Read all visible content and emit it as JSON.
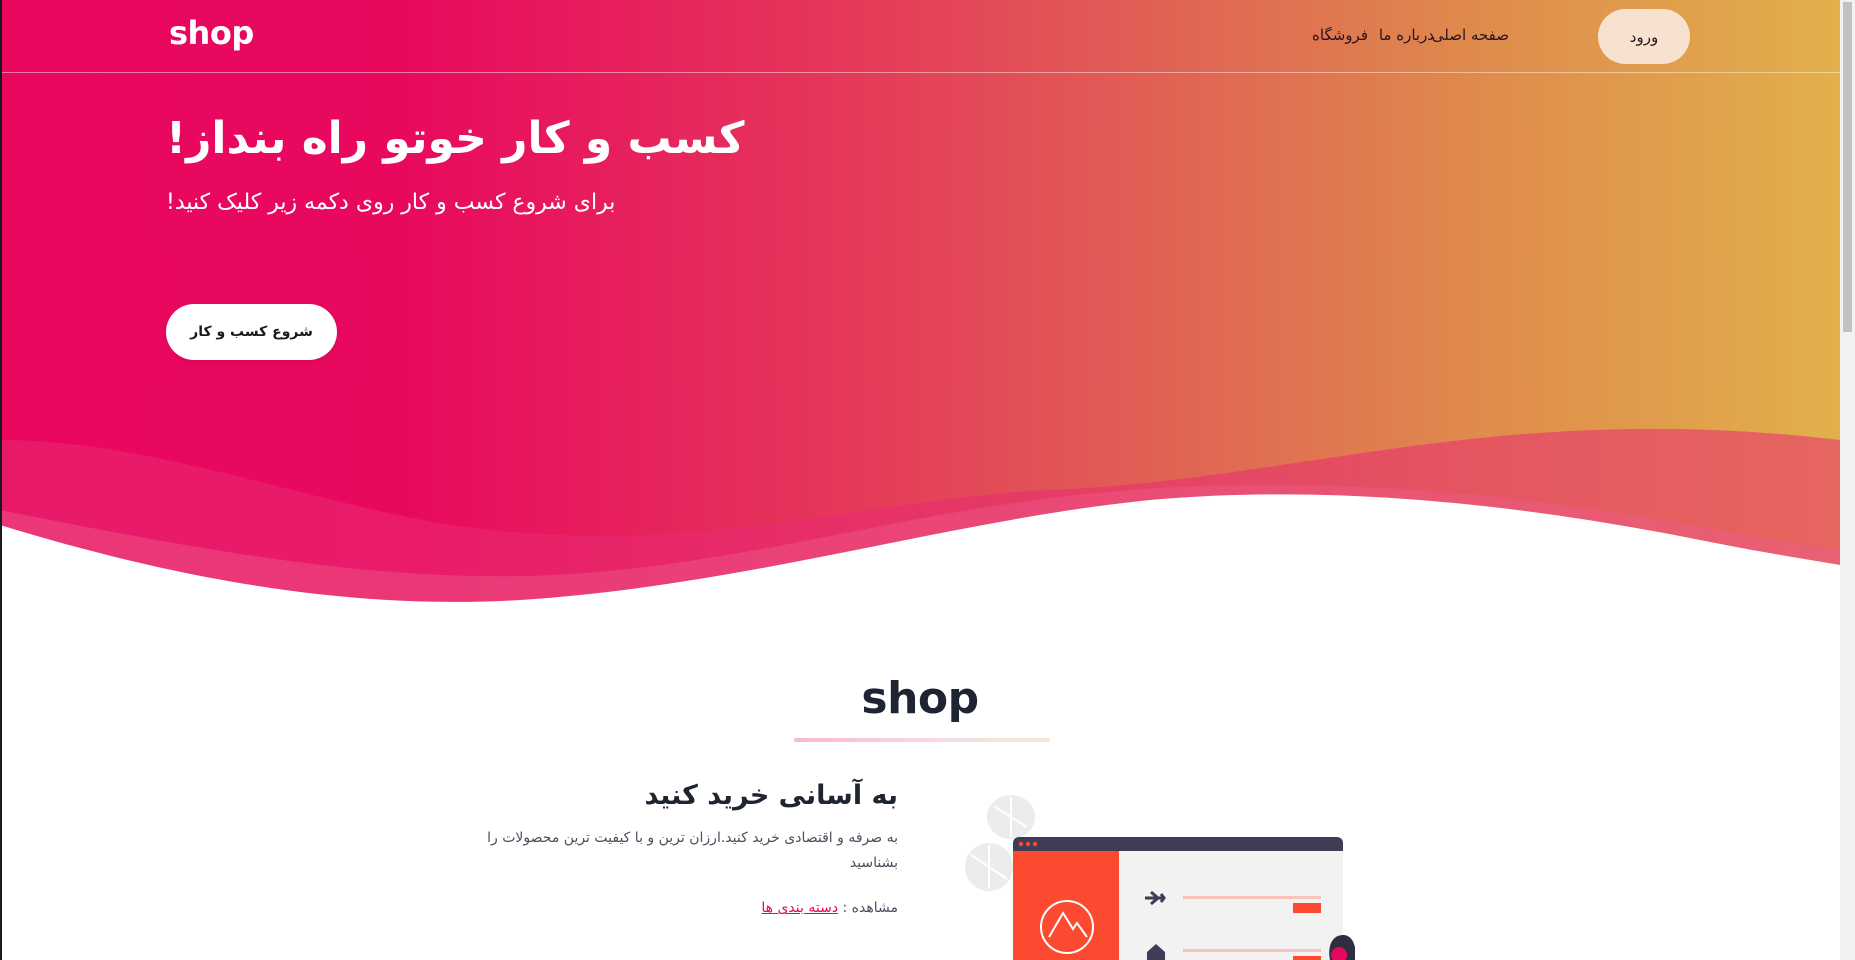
{
  "navbar": {
    "brand": "shop",
    "links": {
      "home": "صفحه اصلی",
      "about": "درباره ما",
      "shop": "فروشگاه"
    },
    "login_label": "ورود"
  },
  "hero": {
    "title": "کسب و کار خوتو راه بنداز!",
    "subtitle": "برای شروع کسب و کار روی دکمه زیر کلیک کنید!",
    "cta_label": "شروع کسب و کار"
  },
  "section": {
    "title": "shop",
    "feature": {
      "title": "به آسانی خرید کنید",
      "description": "به صرفه و اقتصادی خرید کنید.ارزان ترین و با کیفیت ترین محصولات را بشناسید",
      "link_prefix": "مشاهده :",
      "link_label": "دسته بندی ها"
    }
  },
  "icons": {
    "plane": "plane-icon",
    "home": "home-icon",
    "mountain": "mountain-logo-icon"
  },
  "colors": {
    "gradient_start": "#e9065f",
    "gradient_end": "#e2b04b",
    "accent": "#e9065f",
    "login_bg": "#f7e2d0",
    "illustration_red": "#fb4a2f",
    "illustration_dark": "#3f3d56"
  }
}
